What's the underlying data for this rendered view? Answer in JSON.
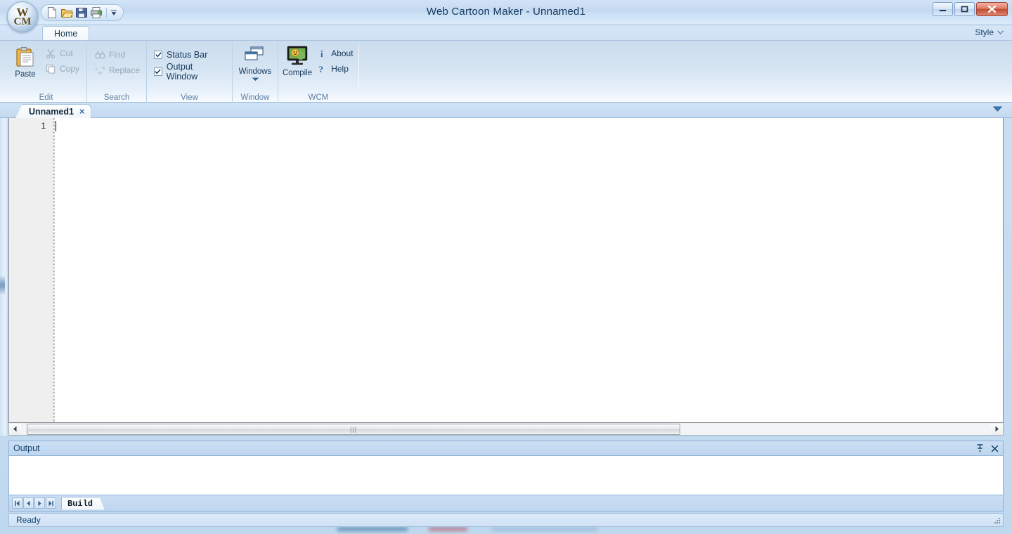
{
  "window": {
    "title": "Web Cartoon Maker - Unnamed1",
    "logo_line1": "W",
    "logo_line2": "CM",
    "minimize_label": "Minimize",
    "maximize_label": "Maximize",
    "close_label": "Close"
  },
  "quick_access": {
    "items": [
      {
        "name": "new-icon",
        "label": "New"
      },
      {
        "name": "open-icon",
        "label": "Open"
      },
      {
        "name": "save-icon",
        "label": "Save"
      },
      {
        "name": "print-icon",
        "label": "Print"
      }
    ],
    "customize_label": "Customize Quick Access Toolbar"
  },
  "ribbon": {
    "tabs": [
      {
        "label": "Home",
        "selected": true
      }
    ],
    "style_menu_label": "Style",
    "groups": [
      {
        "label": "Edit",
        "big_button": {
          "label": "Paste",
          "icon": "paste-icon",
          "enabled": true
        },
        "small_buttons": [
          {
            "label": "Cut",
            "icon": "cut-icon",
            "enabled": false
          },
          {
            "label": "Copy",
            "icon": "copy-icon",
            "enabled": false
          }
        ]
      },
      {
        "label": "Search",
        "small_buttons": [
          {
            "label": "Find",
            "icon": "find-icon",
            "enabled": false
          },
          {
            "label": "Replace",
            "icon": "replace-icon",
            "enabled": false
          }
        ]
      },
      {
        "label": "View",
        "checkboxes": [
          {
            "label": "Status Bar",
            "checked": true
          },
          {
            "label": "Output Window",
            "checked": true
          }
        ]
      },
      {
        "label": "Window",
        "big_button": {
          "label": "Windows",
          "icon": "windows-icon",
          "enabled": true,
          "has_dropdown": true
        }
      },
      {
        "label": "WCM",
        "big_button": {
          "label": "Compile",
          "icon": "compile-icon",
          "enabled": true
        },
        "small_buttons": [
          {
            "label": "About",
            "icon": "info-icon",
            "enabled": true
          },
          {
            "label": "Help",
            "icon": "help-icon",
            "enabled": true
          }
        ]
      }
    ]
  },
  "document_tabs": {
    "tabs": [
      {
        "label": "Unnamed1",
        "close_label": "×",
        "active": true
      }
    ],
    "overflow_label": "Tab list"
  },
  "editor": {
    "line_numbers": [
      "1"
    ],
    "content": ""
  },
  "scrollbar": {
    "left_arrow": "◂",
    "right_arrow": "▸",
    "grip": "|||"
  },
  "output_panel": {
    "title": "Output",
    "pin_label": "Auto Hide",
    "close_label": "Close",
    "content": "",
    "nav_buttons": [
      "⏮",
      "◂",
      "▸",
      "⏭"
    ],
    "tabs": [
      {
        "label": "Build",
        "active": true
      }
    ]
  },
  "status_bar": {
    "message": "Ready"
  },
  "colors": {
    "accent": "#15446e",
    "ribbon_top": "#ccdcee",
    "close_button": "#c04a32",
    "tab_active_bg": "#f2f7fc"
  }
}
